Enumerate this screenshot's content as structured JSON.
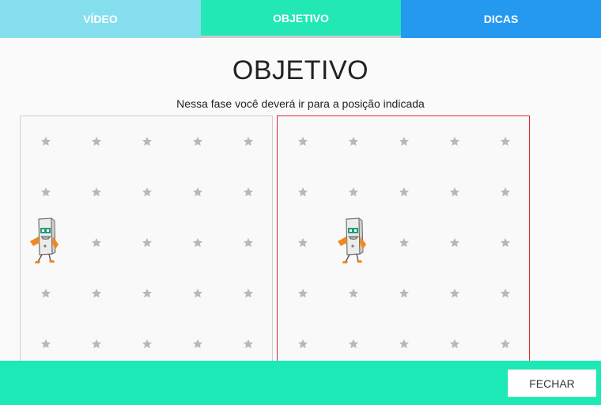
{
  "tabs": [
    {
      "label": "VÍDEO"
    },
    {
      "label": "OBJETIVO"
    },
    {
      "label": "DICAS"
    }
  ],
  "content": {
    "title": "OBJETIVO",
    "subtitle": "Nessa fase você deverá ir para a posição indicada"
  },
  "boards": {
    "grid": {
      "columns": 5,
      "rows": 5
    },
    "current": {
      "robot_cell": {
        "column": 1,
        "row": 3
      }
    },
    "target": {
      "robot_cell": {
        "column": 2,
        "row": 3
      }
    }
  },
  "footer": {
    "close_label": "FECHAR"
  },
  "colors": {
    "tab_video": "#86dfee",
    "tab_objetivo": "#22e8b6",
    "tab_dicas": "#2598f0",
    "footer": "#1de9b6",
    "target_border": "#d9262b",
    "star": "#b8b8b8"
  },
  "icons": {
    "cell_marker": "star-icon",
    "robot": "robot-icon"
  }
}
